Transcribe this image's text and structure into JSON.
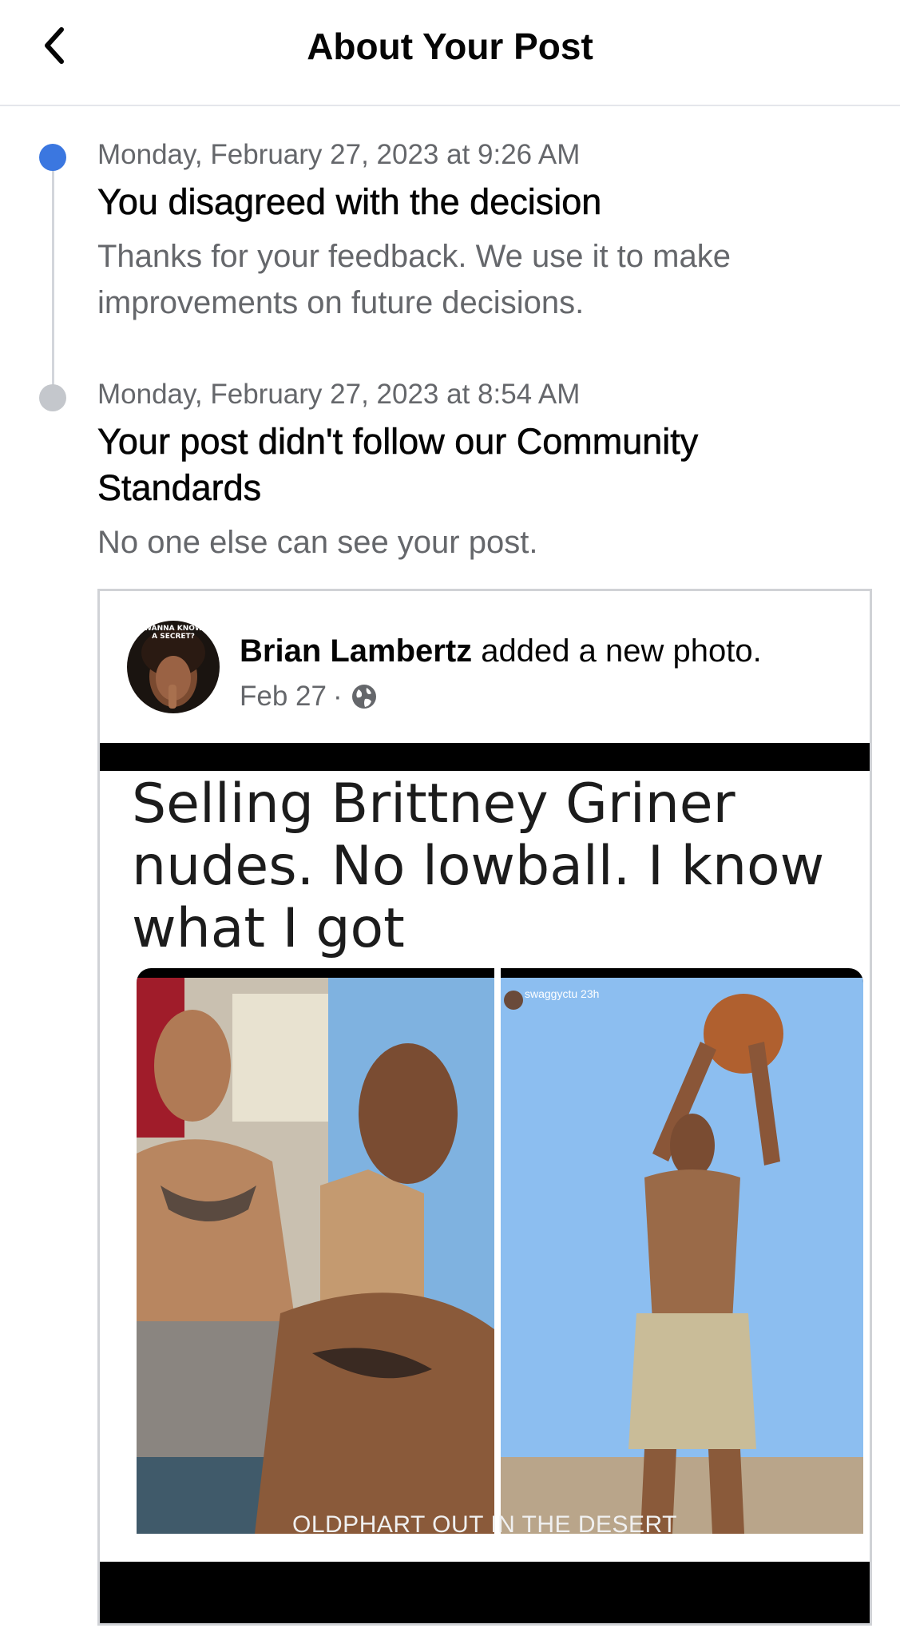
{
  "header": {
    "title": "About Your Post"
  },
  "timeline": [
    {
      "date": "Monday, February 27, 2023 at 9:26 AM",
      "title": "You disagreed with the decision",
      "description": "Thanks for your feedback. We use it to make improvements on future decisions.",
      "dot_color": "#3b77e0"
    },
    {
      "date": "Monday, February 27, 2023 at 8:54 AM",
      "title": "Your post didn't follow our Community Standards",
      "description": "No one else can see your post.",
      "dot_color": "#c4c7cc"
    }
  ],
  "post": {
    "author": "Brian Lambertz",
    "action": " added a new photo.",
    "date": "Feb 27",
    "separator": "·",
    "privacy_icon": "globe-icon",
    "avatar_text": "WANNA KNOW A SECRET?",
    "image": {
      "meme_text": "Selling Brittney Griner nudes. No lowball. I know what I got",
      "story_username": "swaggyctu 23h",
      "caption": "OLDPHART OUT IN THE DESERT"
    }
  }
}
